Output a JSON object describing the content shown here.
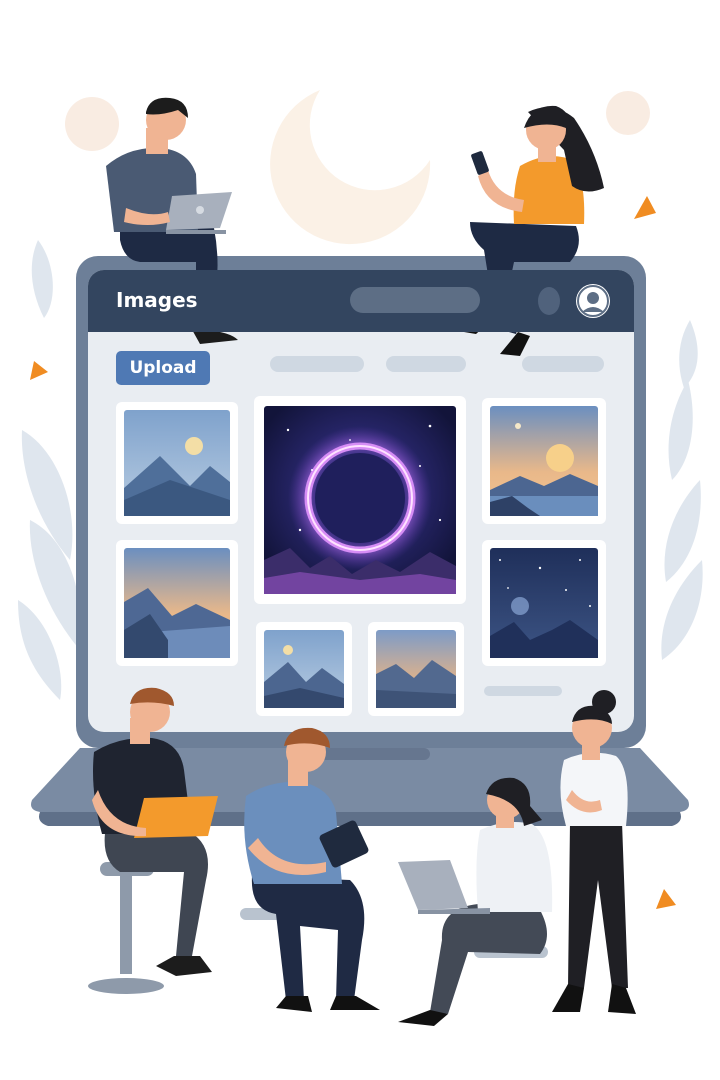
{
  "app": {
    "title": "Images"
  },
  "toolbar": {
    "upload_label": "Upload"
  },
  "colors": {
    "screen_frame": "#6d7f98",
    "topbar": "#33455f",
    "canvas": "#e9edf2",
    "accent": "#4f79b4",
    "orange": "#f39a2c"
  },
  "gallery": {
    "thumbnails": [
      {
        "name": "mountain-sun"
      },
      {
        "name": "cosmic-ring-featured"
      },
      {
        "name": "sunset-lake"
      },
      {
        "name": "dusk-mountains"
      },
      {
        "name": "small-mountains"
      },
      {
        "name": "orange-dusk"
      },
      {
        "name": "night-sky"
      }
    ]
  }
}
